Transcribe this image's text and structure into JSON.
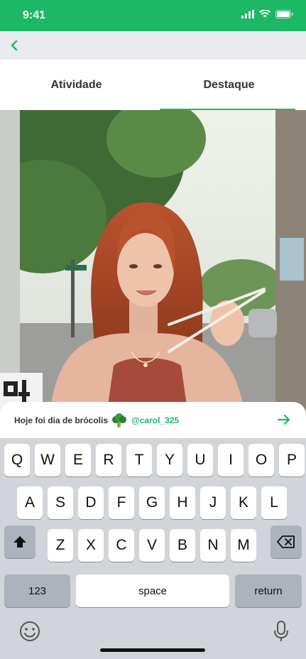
{
  "status_bar": {
    "time": "9:41",
    "icons": [
      "signal-icon",
      "wifi-icon",
      "battery-icon"
    ]
  },
  "nav": {
    "back_icon": "chevron-left-icon"
  },
  "tabs": [
    {
      "label": "Atividade",
      "active": false
    },
    {
      "label": "Destaque",
      "active": true
    }
  ],
  "caption": {
    "text": "Hoje foi dia de brócolis",
    "emoji": "broccoli-icon",
    "user": "@carol_325",
    "send_icon": "arrow-right-icon"
  },
  "keyboard": {
    "row1": [
      "Q",
      "W",
      "E",
      "R",
      "T",
      "Y",
      "U",
      "I",
      "O",
      "P"
    ],
    "row2": [
      "A",
      "S",
      "D",
      "F",
      "G",
      "H",
      "J",
      "K",
      "L"
    ],
    "row3": [
      "Z",
      "X",
      "C",
      "V",
      "B",
      "N",
      "M"
    ],
    "numbers_label": "123",
    "space_label": "space",
    "return_label": "return",
    "shift_icon": "shift-icon",
    "delete_icon": "backspace-icon",
    "emoji_icon": "emoji-icon",
    "mic_icon": "microphone-icon"
  },
  "colors": {
    "accent": "#1db866",
    "keyboard_bg": "#d1d4d9",
    "nav_bg": "#e9ebee"
  }
}
